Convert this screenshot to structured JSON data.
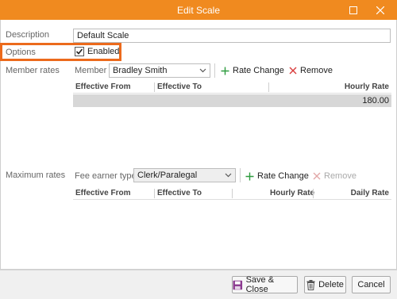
{
  "window": {
    "title": "Edit Scale",
    "accent_color": "#f08a1f",
    "highlight_color": "#ec6a1c"
  },
  "description": {
    "label": "Description",
    "value": "Default Scale"
  },
  "options": {
    "label": "Options",
    "enabled_label": "Enabled",
    "enabled_checked": true
  },
  "member_rates": {
    "label": "Member rates",
    "member_label": "Member",
    "member_value": "Bradley Smith",
    "rate_change_label": "Rate Change",
    "remove_label": "Remove",
    "columns": [
      "Effective From",
      "Effective To",
      "Hourly Rate"
    ],
    "rows": [
      {
        "effective_from": "",
        "effective_to": "",
        "hourly_rate": "180.00"
      }
    ]
  },
  "maximum_rates": {
    "label": "Maximum rates",
    "fee_earner_label": "Fee earner type",
    "fee_earner_value": "Clerk/Paralegal",
    "rate_change_label": "Rate Change",
    "remove_label": "Remove",
    "columns": [
      "Effective From",
      "Effective To",
      "Hourly Rate",
      "Daily Rate"
    ]
  },
  "footer": {
    "save_close_label": "Save & Close",
    "delete_label": "Delete",
    "cancel_label": "Cancel"
  },
  "icons": {
    "maximize": "maximize-icon",
    "close": "close-icon",
    "checkmark": "checkmark-icon",
    "plus": "plus-icon",
    "remove": "x-icon",
    "save": "floppy-disk-icon",
    "delete": "trash-icon",
    "chevron": "chevron-down-icon"
  }
}
